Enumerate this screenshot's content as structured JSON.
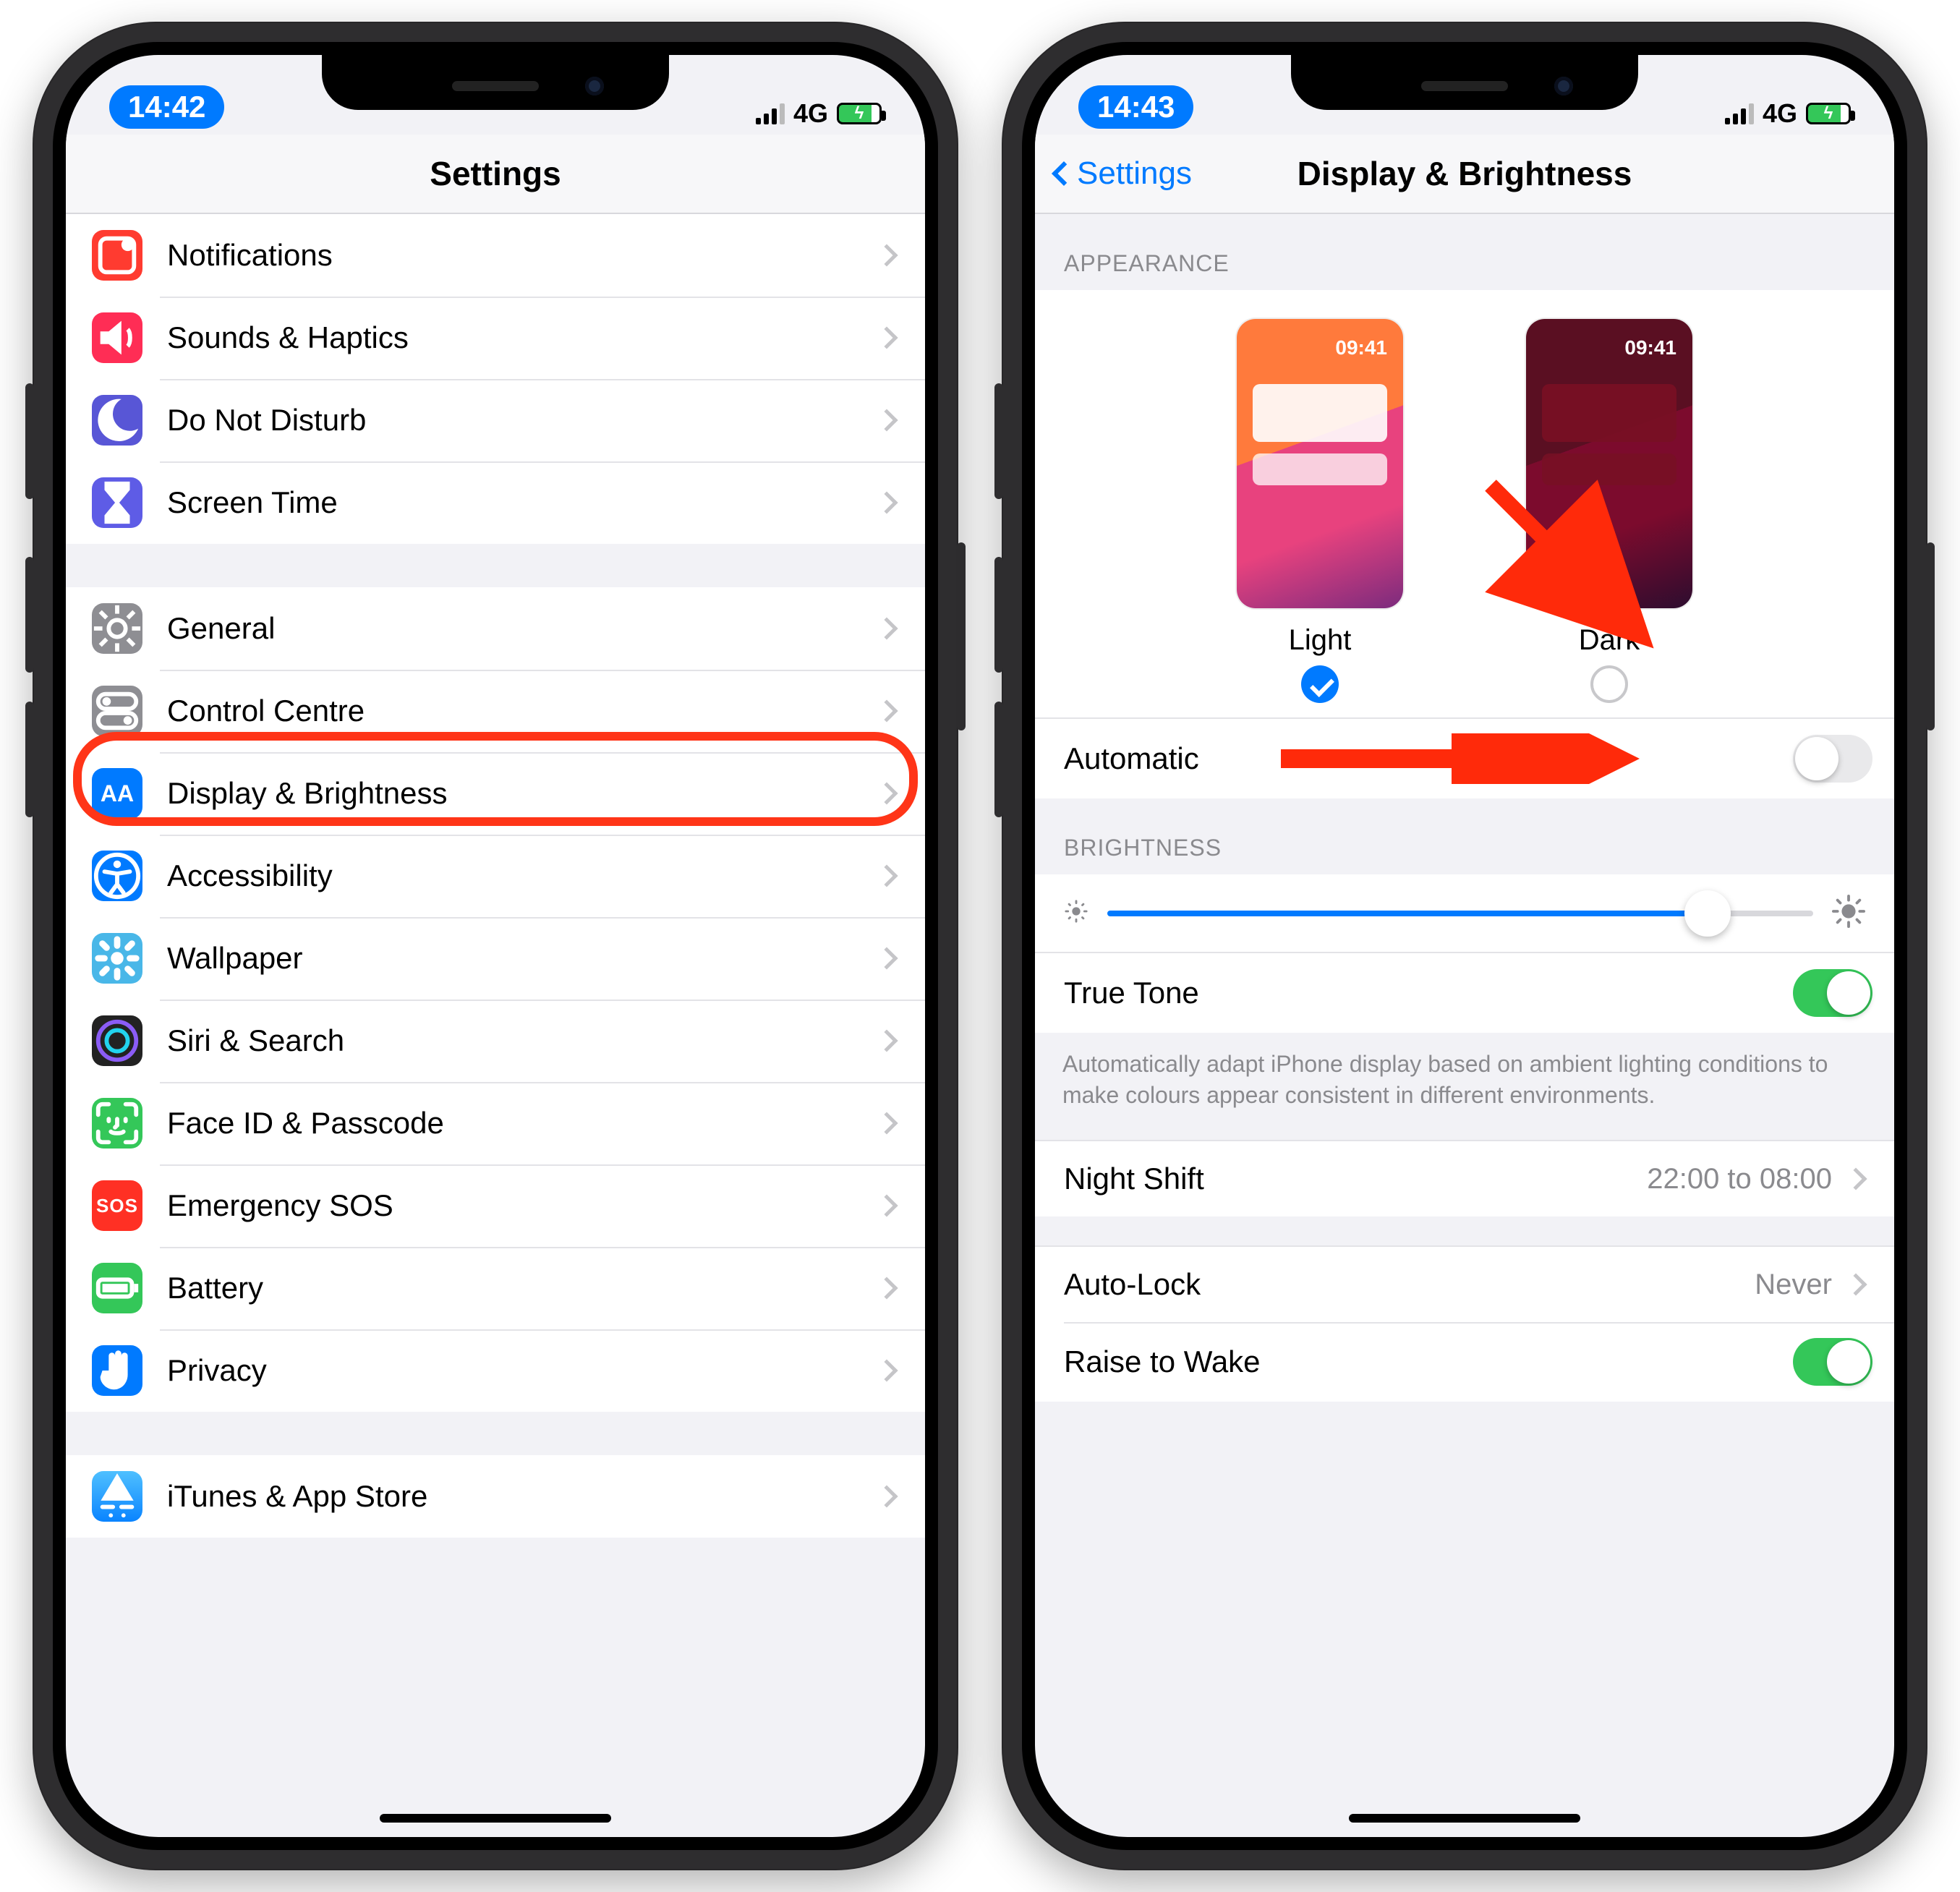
{
  "status": {
    "left_time": "14:42",
    "right_time": "14:43",
    "network": "4G"
  },
  "settings": {
    "title": "Settings",
    "items": [
      {
        "label": "Notifications",
        "icon": "notifications-icon",
        "color": "ic-red"
      },
      {
        "label": "Sounds & Haptics",
        "icon": "speaker-icon",
        "color": "ic-pink"
      },
      {
        "label": "Do Not Disturb",
        "icon": "moon-icon",
        "color": "ic-purple"
      },
      {
        "label": "Screen Time",
        "icon": "hourglass-icon",
        "color": "ic-indigo"
      }
    ],
    "group2": [
      {
        "label": "General",
        "icon": "gear-icon",
        "color": "ic-gray"
      },
      {
        "label": "Control Centre",
        "icon": "switches-icon",
        "color": "ic-gray"
      },
      {
        "label": "Display & Brightness",
        "icon": "aa-icon",
        "color": "ic-blue",
        "highlight": true
      },
      {
        "label": "Accessibility",
        "icon": "accessibility-icon",
        "color": "ic-blue"
      },
      {
        "label": "Wallpaper",
        "icon": "flower-icon",
        "color": "ic-blue"
      },
      {
        "label": "Siri & Search",
        "icon": "siri-icon",
        "color": "ic-black"
      },
      {
        "label": "Face ID & Passcode",
        "icon": "faceid-icon",
        "color": "ic-green"
      },
      {
        "label": "Emergency SOS",
        "icon": "sos-icon",
        "color": "ic-sos"
      },
      {
        "label": "Battery",
        "icon": "battery-icon",
        "color": "ic-green"
      },
      {
        "label": "Privacy",
        "icon": "hand-icon",
        "color": "ic-blue"
      }
    ],
    "group3": [
      {
        "label": "iTunes & App Store",
        "icon": "appstore-icon",
        "color": "ic-blue"
      }
    ]
  },
  "display": {
    "back_label": "Settings",
    "title": "Display & Brightness",
    "section_appearance": "APPEARANCE",
    "opt_light": "Light",
    "opt_dark": "Dark",
    "thumb_time": "09:41",
    "automatic_label": "Automatic",
    "automatic_on": false,
    "section_brightness": "BRIGHTNESS",
    "truetone_label": "True Tone",
    "truetone_on": true,
    "truetone_note": "Automatically adapt iPhone display based on ambient lighting conditions to make colours appear consistent in different environments.",
    "nightshift_label": "Night Shift",
    "nightshift_value": "22:00 to 08:00",
    "autolock_label": "Auto-Lock",
    "autolock_value": "Never",
    "raisetowake_label": "Raise to Wake",
    "raisetowake_on": true
  }
}
